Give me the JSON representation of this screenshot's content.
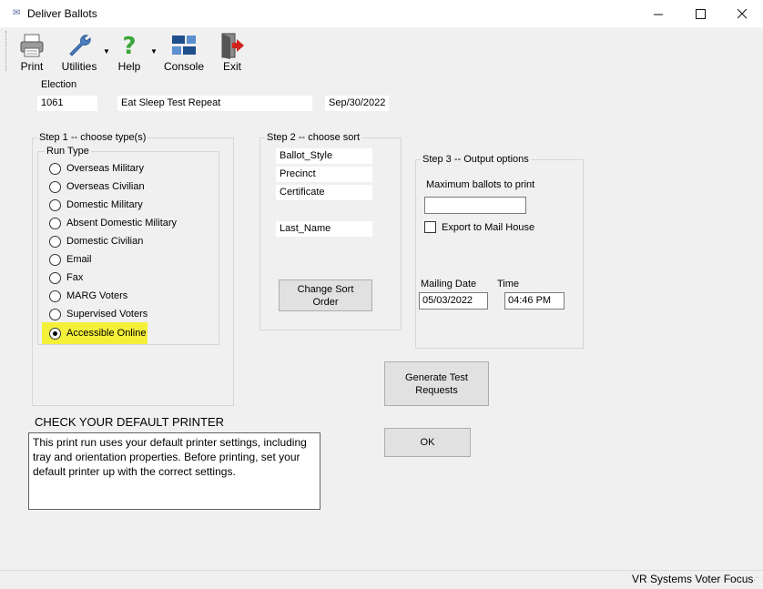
{
  "window": {
    "title": "Deliver Ballots",
    "minimize": "—",
    "maximize": "☐",
    "close": "✕"
  },
  "toolbar": {
    "print": "Print",
    "utilities": "Utilities",
    "help": "Help",
    "console": "Console",
    "exit": "Exit"
  },
  "election": {
    "label": "Election",
    "number": "1061",
    "name": "Eat Sleep Test Repeat",
    "date": "Sep/30/2022"
  },
  "step1": {
    "title": "Step 1 -- choose type(s)",
    "run_type_label": "Run Type",
    "options": [
      {
        "label": "Overseas Military",
        "selected": false
      },
      {
        "label": "Overseas Civilian",
        "selected": false
      },
      {
        "label": "Domestic Military",
        "selected": false
      },
      {
        "label": "Absent Domestic Military",
        "selected": false
      },
      {
        "label": "Domestic Civilian",
        "selected": false
      },
      {
        "label": "Email",
        "selected": false
      },
      {
        "label": "Fax",
        "selected": false
      },
      {
        "label": "MARG Voters",
        "selected": false
      },
      {
        "label": "Supervised Voters",
        "selected": false
      },
      {
        "label": "Accessible Online",
        "selected": true
      }
    ]
  },
  "step2": {
    "title": "Step 2 -- choose sort",
    "sort_fields": [
      "Ballot_Style",
      "Precinct",
      "Certificate",
      "Last_Name"
    ],
    "change_sort_button": "Change Sort Order"
  },
  "step3": {
    "title": "Step 3 -- Output options",
    "max_ballots_label": "Maximum ballots to print",
    "max_ballots_value": "",
    "export_label": "Export to Mail House",
    "export_checked": false,
    "mailing_date_label": "Mailing Date",
    "mailing_date_value": "05/03/2022",
    "time_label": "Time",
    "time_value": "04:46 PM"
  },
  "generate_button": "Generate Test Requests",
  "ok_button": "OK",
  "printer": {
    "heading": "CHECK YOUR DEFAULT PRINTER",
    "message": "This print run uses your default printer settings, including tray and orientation properties.  Before printing, set your default printer up with the correct settings."
  },
  "status_bar": {
    "text": "VR Systems Voter Focus"
  },
  "colors": {
    "highlight": "#f4f03a",
    "console_icon": "#1f4e8c",
    "exit_arrow": "#d0231e",
    "help_icon": "#3aa53a"
  }
}
